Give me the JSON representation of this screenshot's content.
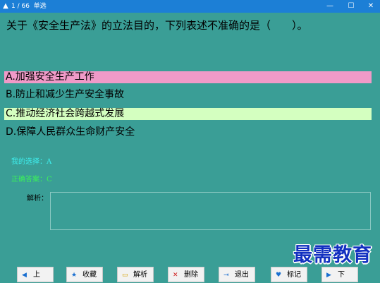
{
  "window": {
    "counter": "1 / 66",
    "type": "单选",
    "controls": {
      "minimize": "—",
      "maximize": "☐",
      "close": "✕"
    }
  },
  "question": "关于《安全生产法》的立法目的，下列表述不准确的是（　　）。",
  "options": [
    {
      "text": "A.加强安全生产工作",
      "highlight": "#f09ac8"
    },
    {
      "text": "B.防止和减少生产安全事故",
      "highlight": null
    },
    {
      "text": "C.推动经济社会跨越式发展",
      "highlight": "#d4ffc0"
    },
    {
      "text": "D.保障人民群众生命财产安全",
      "highlight": null
    }
  ],
  "my_choice": "我的选择：A",
  "correct_answer": "正确答案：C",
  "analysis_label": "解析：",
  "watermark": "最需教育",
  "buttons": [
    {
      "label": "上",
      "icon": "arrow-left-icon",
      "glyph": "◀"
    },
    {
      "label": "收藏",
      "icon": "star-icon",
      "glyph": "★"
    },
    {
      "label": "解析",
      "icon": "analysis-icon",
      "glyph": "▭"
    },
    {
      "label": "删除",
      "icon": "delete-icon",
      "glyph": "✕"
    },
    {
      "label": "退出",
      "icon": "exit-icon",
      "glyph": "⇥"
    },
    {
      "label": "标记",
      "icon": "mark-icon",
      "glyph": "♥"
    },
    {
      "label": "下",
      "icon": "arrow-right-icon",
      "glyph": "▶"
    }
  ],
  "colors": {
    "background": "#3a9e96",
    "titlebar": "#1c7fd6",
    "my_choice": "#3ef0f0",
    "correct": "#3cf05a",
    "watermark": "#1230c0"
  }
}
